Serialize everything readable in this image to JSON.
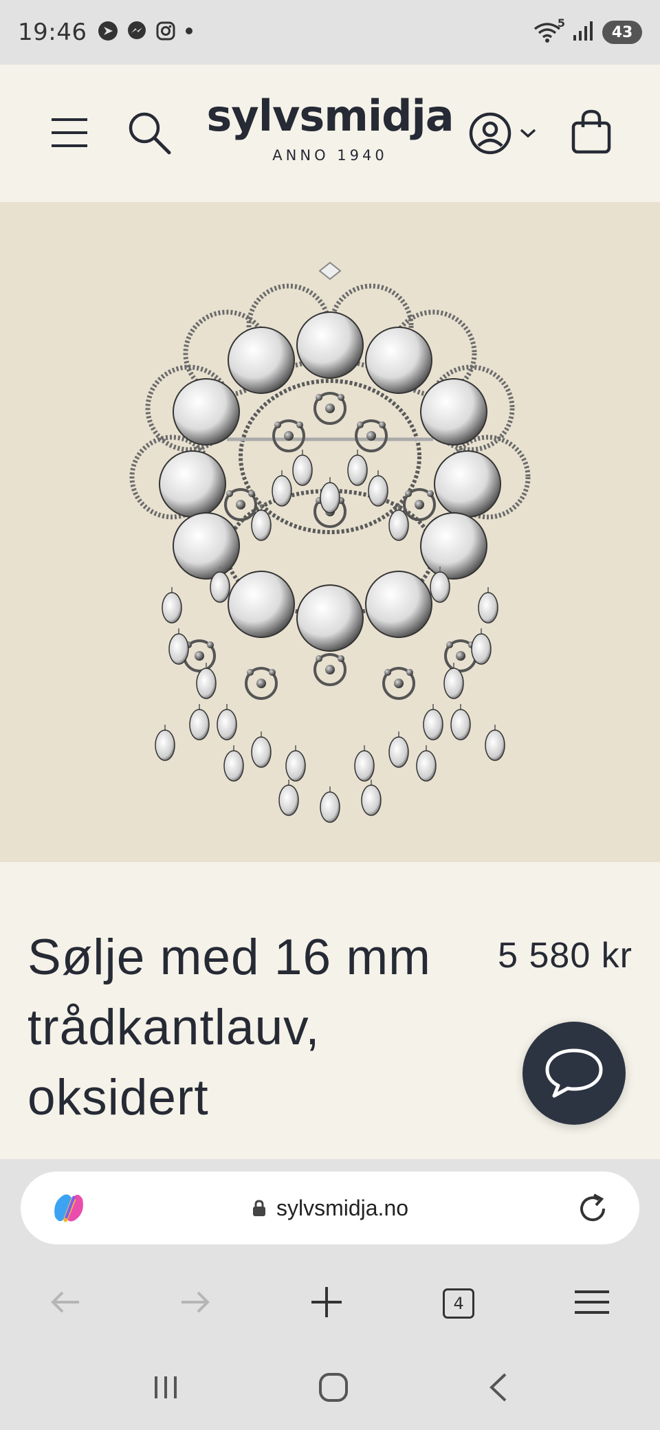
{
  "status_bar": {
    "time": "19:46",
    "notification_icons": [
      "direct-icon",
      "messenger-icon",
      "instagram-icon",
      "dot-icon"
    ],
    "wifi_badge": "5",
    "battery": "43"
  },
  "header": {
    "logo_main": "sylvsmidja",
    "logo_sub": "ANNO 1940",
    "icons": [
      "menu-icon",
      "search-icon",
      "account-icon",
      "chevron-down-icon",
      "cart-icon"
    ]
  },
  "product": {
    "image_subject": "silver-brooch",
    "title": "Sølje med 16 mm trådkantlauv, oksidert",
    "price": "5 580 kr"
  },
  "chat": {
    "icon": "chat-bubble-icon"
  },
  "browser": {
    "url": "sylvsmidja.no",
    "tab_count": "4",
    "icons": [
      "copilot-icon",
      "lock-icon",
      "reload-icon",
      "back-icon",
      "forward-icon",
      "new-tab-icon",
      "tabs-icon",
      "menu-icon"
    ]
  },
  "colors": {
    "header_bg": "#f5f2e9",
    "image_bg": "#e8e1d0",
    "text": "#262a35",
    "chat_button": "#2c3341",
    "system_bg": "#e2e2e2"
  }
}
